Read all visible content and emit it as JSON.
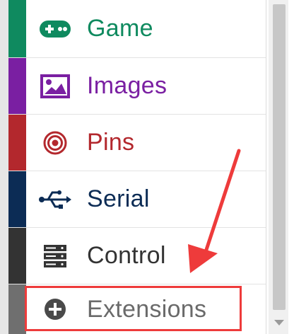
{
  "toolbox": {
    "categories": [
      {
        "label": "Game",
        "color": "#0f8a5f",
        "icon": "gamepad-icon"
      },
      {
        "label": "Images",
        "color": "#7a1fa2",
        "icon": "image-icon"
      },
      {
        "label": "Pins",
        "color": "#b3282d",
        "icon": "target-icon"
      },
      {
        "label": "Serial",
        "color": "#0c2c55",
        "icon": "usb-icon"
      },
      {
        "label": "Control",
        "color": "#333333",
        "icon": "server-icon"
      },
      {
        "label": "Extensions",
        "color": "#6f6f6f",
        "icon": "plus-circle-icon"
      }
    ]
  },
  "annotation": {
    "arrow_color": "#ee3b3b",
    "highlight_color": "#ee3b3b"
  }
}
